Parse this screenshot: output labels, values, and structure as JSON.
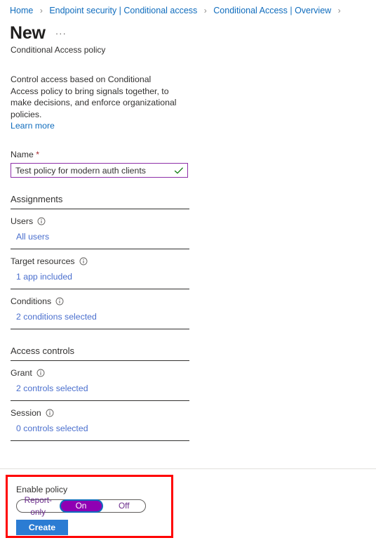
{
  "breadcrumb": {
    "items": [
      {
        "label": "Home"
      },
      {
        "label": "Endpoint security | Conditional access"
      },
      {
        "label": "Conditional Access | Overview"
      }
    ],
    "separator": "›"
  },
  "header": {
    "title": "New",
    "more_menu": "···",
    "subtitle": "Conditional Access policy"
  },
  "intro": {
    "description": "Control access based on Conditional Access policy to bring signals together, to make decisions, and enforce organizational policies.",
    "learn_more": "Learn more"
  },
  "name_field": {
    "label": "Name",
    "required_marker": "*",
    "value": "Test policy for modern auth clients",
    "placeholder": "",
    "valid_icon": "checkmark-icon",
    "border_color": "#8e2fa8",
    "check_color": "#107c10"
  },
  "sections": [
    {
      "heading": "Assignments",
      "rows": [
        {
          "label": "Users",
          "info_icon": "info-icon",
          "value": "All users"
        },
        {
          "label": "Target resources",
          "info_icon": "info-icon",
          "value": "1 app included"
        },
        {
          "label": "Conditions",
          "info_icon": "info-icon",
          "value": "2 conditions selected"
        }
      ]
    },
    {
      "heading": "Access controls",
      "rows": [
        {
          "label": "Grant",
          "info_icon": "info-icon",
          "value": "2 controls selected"
        },
        {
          "label": "Session",
          "info_icon": "info-icon",
          "value": "0 controls selected"
        }
      ]
    }
  ],
  "footer": {
    "enable_label": "Enable policy",
    "toggle": {
      "options": [
        "Report-only",
        "On",
        "Off"
      ],
      "selected": "On",
      "selected_color": "#8f00b3",
      "focus_ring_color": "#0f6cbd",
      "text_color": "#6b2d8c"
    },
    "create_button": "Create",
    "create_button_color": "#2b7cd3",
    "highlight_color": "#ff0000"
  },
  "colors": {
    "link": "#0f6cbd",
    "value_link": "#4a6fce",
    "text": "#323130",
    "required": "#a4262c"
  }
}
